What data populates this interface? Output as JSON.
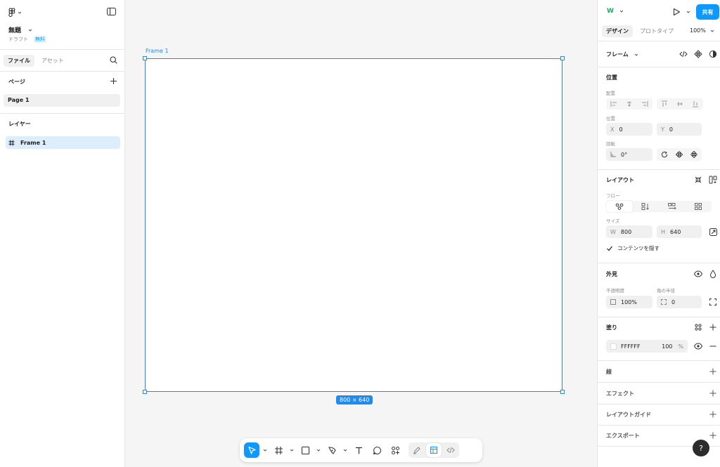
{
  "file": {
    "title": "無題",
    "status": "ドラフト",
    "plan_badge": "無料"
  },
  "left_tabs": [
    {
      "label": "ファイル",
      "active": true
    },
    {
      "label": "アセット",
      "active": false
    }
  ],
  "pages": {
    "title": "ページ",
    "items": [
      "Page 1"
    ]
  },
  "layers": {
    "title": "レイヤー",
    "items": [
      "Frame 1"
    ]
  },
  "canvas": {
    "frame_label": "Frame 1",
    "size_badge": "800 × 640"
  },
  "right_header": {
    "tabs": [
      {
        "label": "デザイン",
        "active": true
      },
      {
        "label": "プロトタイプ",
        "active": false
      }
    ],
    "zoom": "100%",
    "share_label": "共有",
    "avatar_initial": "W"
  },
  "frame_section": {
    "title": "フレーム"
  },
  "position": {
    "title": "位置",
    "align_label": "配置",
    "pos_label": "位置",
    "x_key": "X",
    "x_value": "0",
    "y_key": "Y",
    "y_value": "0",
    "rotation_label": "回転",
    "rotation_value": "0°"
  },
  "layout": {
    "title": "レイアウト",
    "flow_label": "フロー",
    "size_label": "サイズ",
    "w_key": "W",
    "w_value": "800",
    "h_key": "H",
    "h_value": "640",
    "clip_label": "コンテンツを隠す"
  },
  "appearance": {
    "title": "外見",
    "opacity_label": "不透明度",
    "opacity_value": "100%",
    "radius_label": "角の半径",
    "radius_value": "0"
  },
  "fill": {
    "title": "塗り",
    "hex": "FFFFFF",
    "opacity": "100",
    "unit": "%"
  },
  "sections": {
    "stroke": "線",
    "effects": "エフェクト",
    "layout_grid": "レイアウトガイド",
    "export": "エクスポート"
  },
  "help_label": "?",
  "colors": {
    "accent": "#0d99ff",
    "frame_stroke": "#1d8bf1",
    "canvas_bg": "#f5f5f5"
  }
}
